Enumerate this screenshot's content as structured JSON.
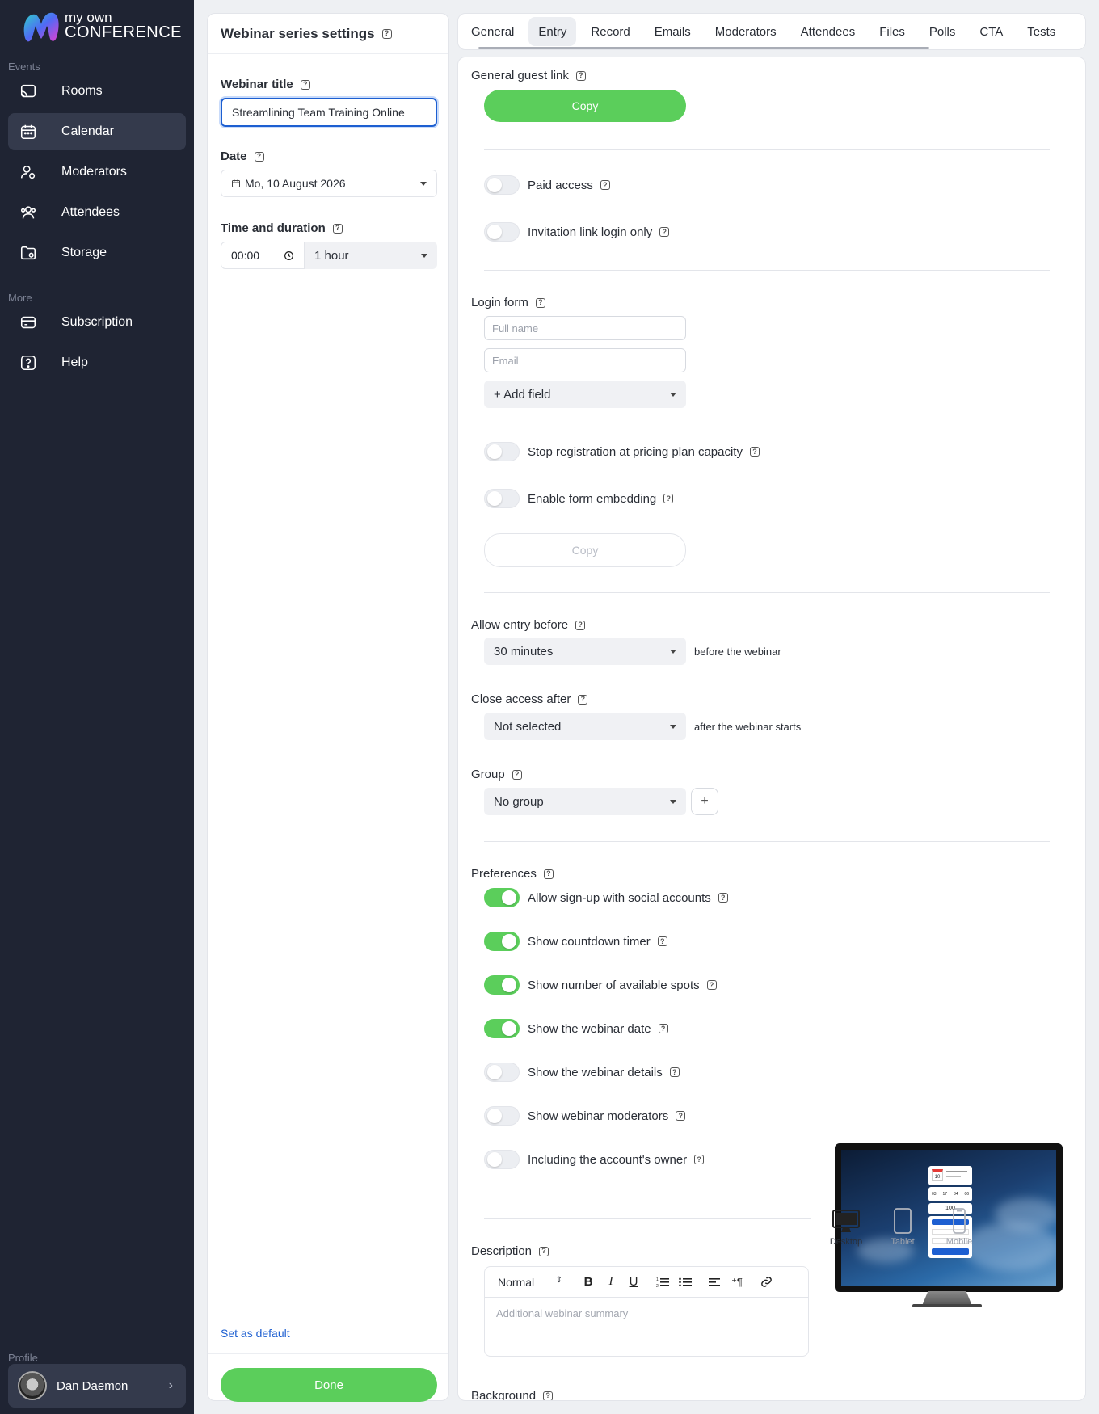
{
  "brand": {
    "line1": "my own",
    "line2": "CONFERENCE"
  },
  "sidebar": {
    "events_label": "Events",
    "more_label": "More",
    "profile_label": "Profile",
    "items": [
      {
        "label": "Rooms",
        "icon": "cast-icon"
      },
      {
        "label": "Calendar",
        "icon": "calendar-icon",
        "active": true
      },
      {
        "label": "Moderators",
        "icon": "moderator-icon"
      },
      {
        "label": "Attendees",
        "icon": "users-icon"
      },
      {
        "label": "Storage",
        "icon": "folder-icon"
      }
    ],
    "more_items": [
      {
        "label": "Subscription",
        "icon": "card-icon"
      },
      {
        "label": "Help",
        "icon": "help-icon"
      }
    ],
    "profile_name": "Dan Daemon"
  },
  "settings": {
    "title": "Webinar series settings",
    "webinar_title_label": "Webinar title",
    "webinar_title_value": "Streamlining Team Training Online",
    "date_label": "Date",
    "date_value": "Mo, 10 August 2026",
    "time_label": "Time and duration",
    "time_value": "00:00",
    "duration_value": "1 hour",
    "set_default": "Set as default",
    "done": "Done"
  },
  "tabs": [
    "General",
    "Entry",
    "Record",
    "Emails",
    "Moderators",
    "Attendees",
    "Files",
    "Polls",
    "CTA",
    "Tests"
  ],
  "active_tab": "Entry",
  "entry": {
    "guest_link_label": "General guest link",
    "copy_label": "Copy",
    "paid_access": "Paid access",
    "invitation_only": "Invitation link login only",
    "login_form_label": "Login form",
    "full_name_placeholder": "Full name",
    "email_placeholder": "Email",
    "add_field": "+ Add field",
    "stop_registration": "Stop registration at pricing plan capacity",
    "enable_embedding": "Enable form embedding",
    "embed_copy": "Copy",
    "allow_entry_label": "Allow entry before",
    "allow_entry_value": "30 minutes",
    "allow_entry_hint": "before the webinar",
    "close_access_label": "Close access after",
    "close_access_value": "Not selected",
    "close_access_hint": "after the webinar starts",
    "group_label": "Group",
    "group_value": "No group",
    "preferences_label": "Preferences",
    "preferences": [
      {
        "label": "Allow sign-up with social accounts",
        "on": true
      },
      {
        "label": "Show countdown timer",
        "on": true
      },
      {
        "label": "Show number of available spots",
        "on": true
      },
      {
        "label": "Show the webinar date",
        "on": true
      },
      {
        "label": "Show the webinar details",
        "on": false
      },
      {
        "label": "Show webinar moderators",
        "on": false
      },
      {
        "label": "Including the account's owner",
        "on": false
      }
    ],
    "description_label": "Description",
    "editor_format": "Normal",
    "description_placeholder": "Additional webinar summary",
    "background_label": "Background",
    "preview_devices": [
      "Desktop",
      "Tablet",
      "Mobile"
    ],
    "preview_spots": "100",
    "preview_countdown": [
      "03",
      "17",
      "34",
      "06"
    ],
    "preview_day": "10"
  },
  "colors": {
    "accent_green": "#5bce5b",
    "sidebar_bg": "#1f2433",
    "link_blue": "#1d5fd1"
  }
}
